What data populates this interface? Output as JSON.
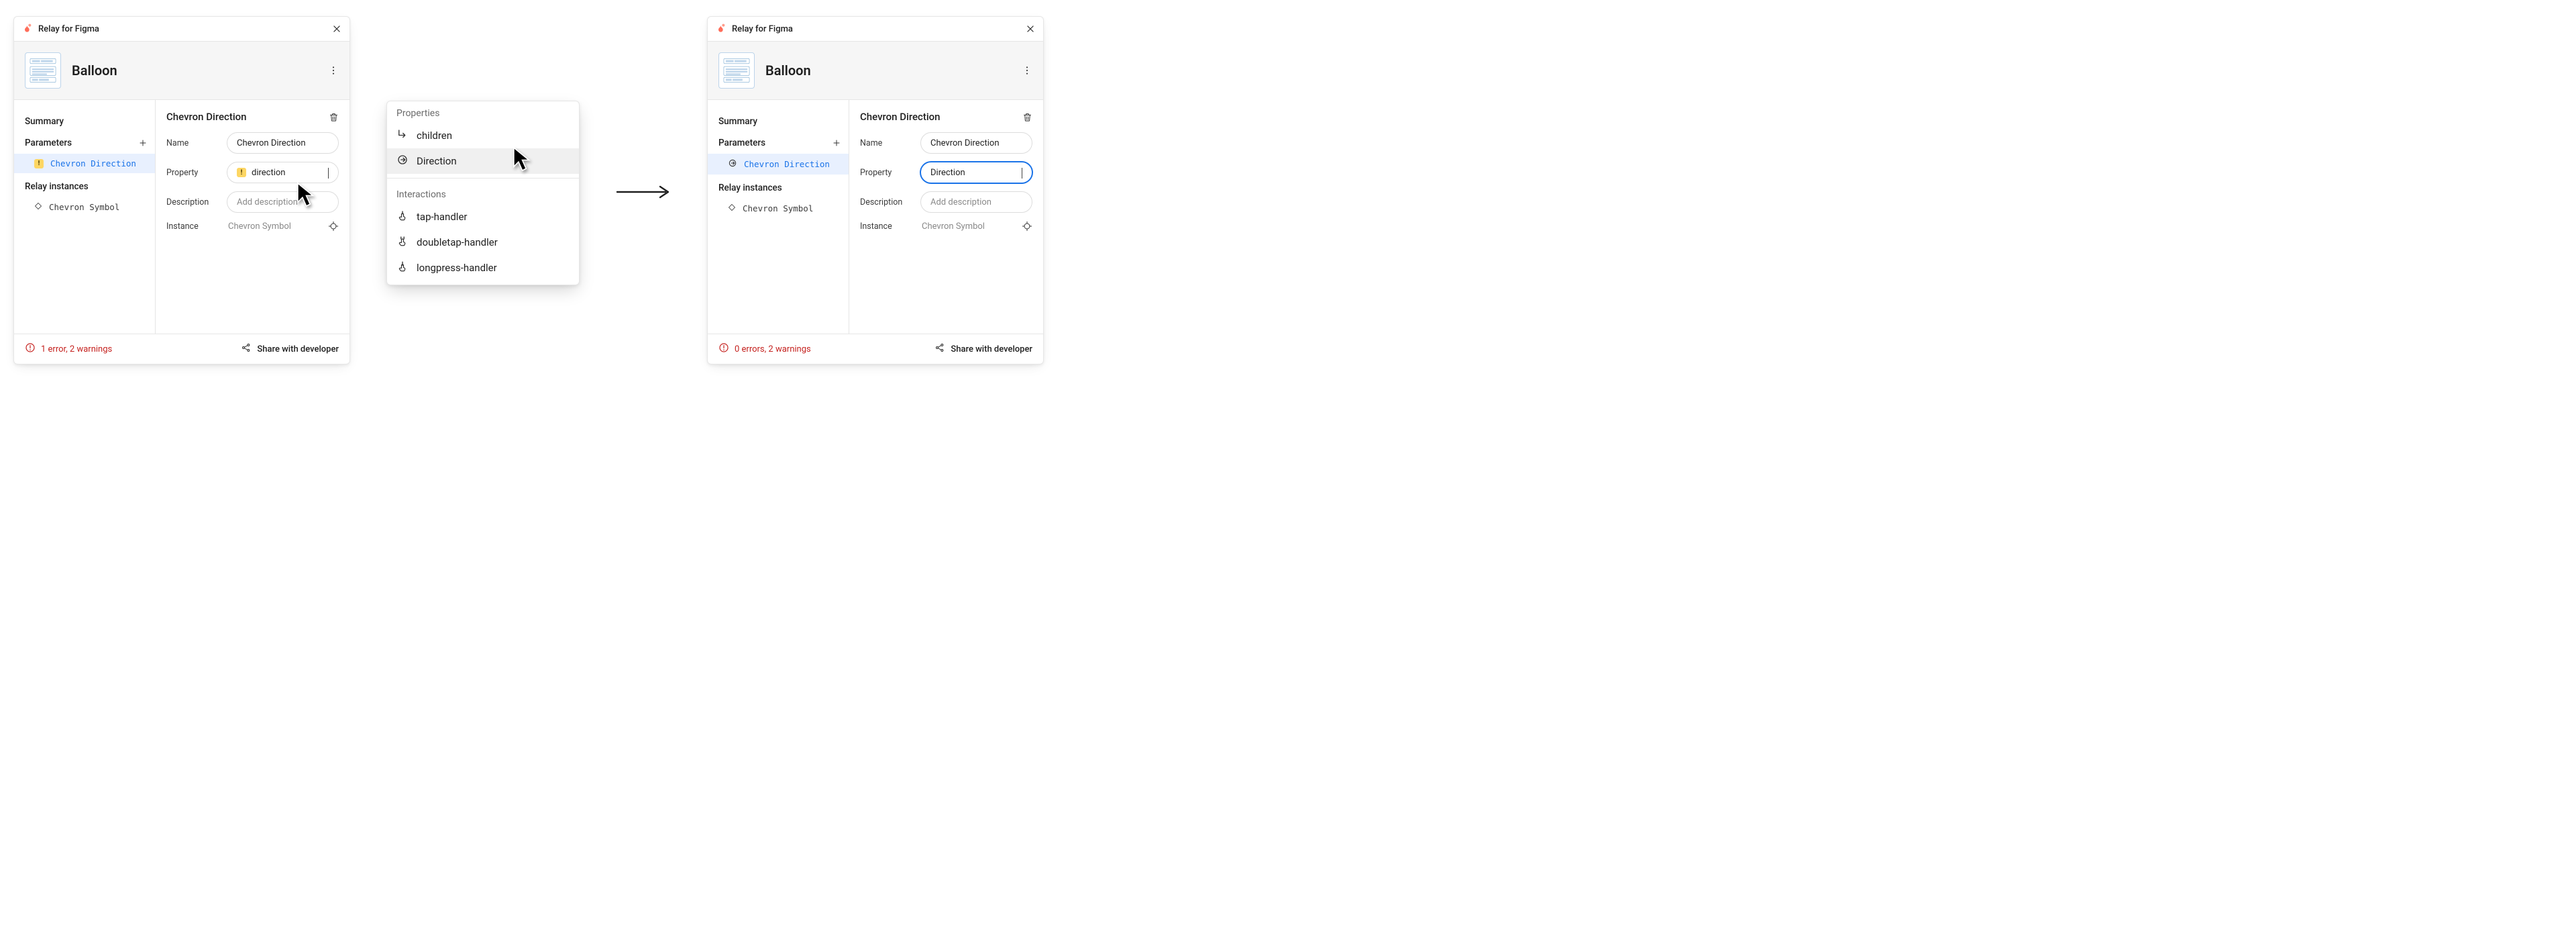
{
  "colors": {
    "link": "#1a73e8",
    "error": "#c5221f",
    "accent": "#1a73e8",
    "warn_bg": "#fdd663"
  },
  "plugin_title": "Relay for Figma",
  "component_name": "Balloon",
  "sidebar": {
    "summary_label": "Summary",
    "parameters_label": "Parameters",
    "relay_instances_label": "Relay instances"
  },
  "popover": {
    "properties_label": "Properties",
    "interactions_label": "Interactions",
    "properties": [
      "children",
      "Direction"
    ],
    "interactions": [
      "tap-handler",
      "doubletap-handler",
      "longpress-handler"
    ],
    "highlighted": "Direction"
  },
  "details": {
    "title": "Chevron Direction",
    "name_label": "Name",
    "property_label": "Property",
    "description_label": "Description",
    "description_placeholder": "Add description",
    "instance_label": "Instance",
    "instance_value": "Chevron Symbol"
  },
  "before": {
    "param_name": "Chevron Direction",
    "name_value": "Chevron Direction",
    "property_value": "direction",
    "property_has_warning": true,
    "instance_name": "Chevron Symbol",
    "status_text": "1 error, 2 warnings"
  },
  "after": {
    "param_name": "Chevron Direction",
    "name_value": "Chevron Direction",
    "property_value": "Direction",
    "property_has_warning": false,
    "instance_name": "Chevron Symbol",
    "status_text": "0 errors, 2 warnings"
  },
  "share_label": "Share with developer"
}
